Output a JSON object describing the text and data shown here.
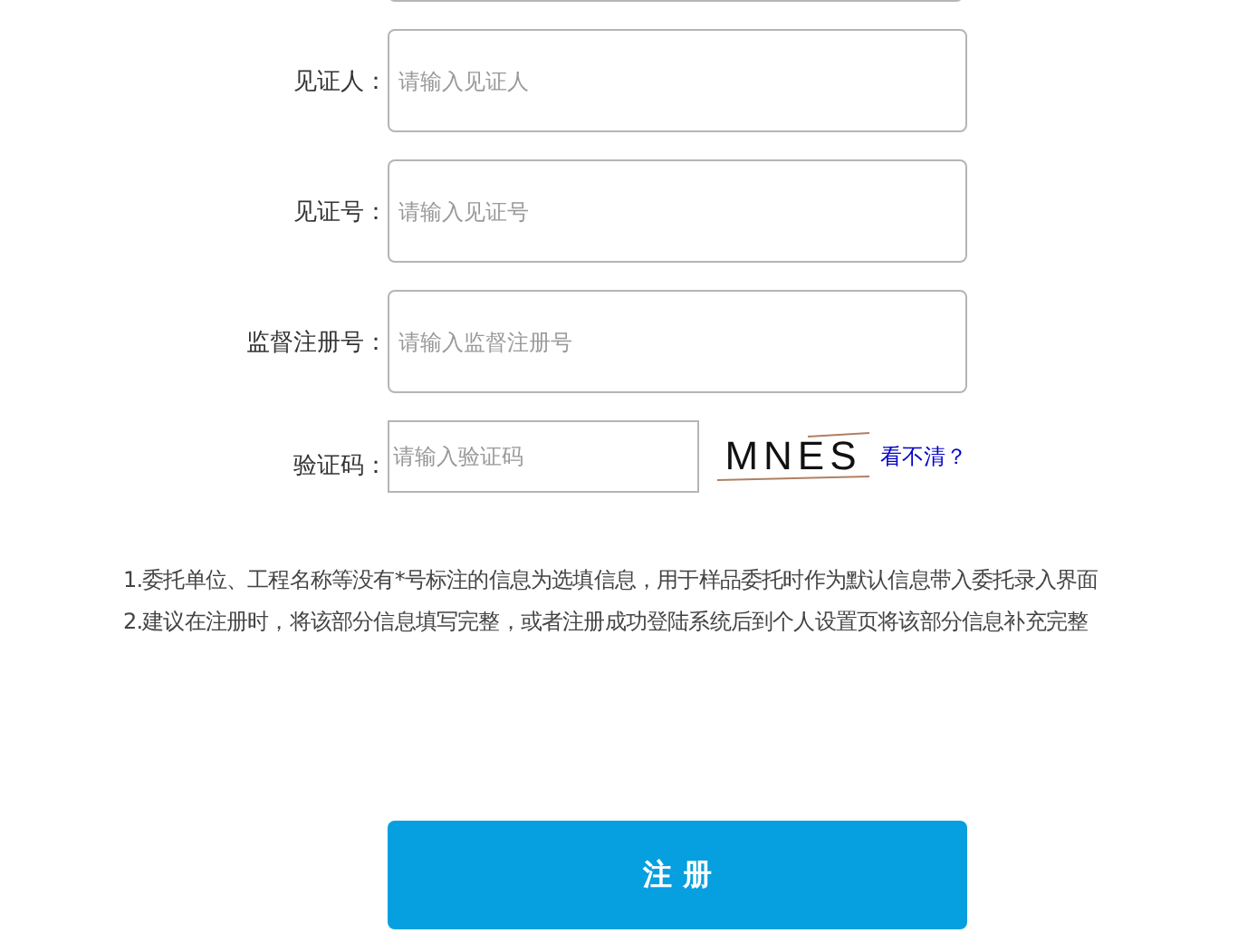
{
  "fields": [
    {
      "label": "见证人：",
      "placeholder": "请输入见证人"
    },
    {
      "label": "见证号：",
      "placeholder": "请输入见证号"
    },
    {
      "label": "监督注册号：",
      "placeholder": "请输入监督注册号"
    }
  ],
  "captcha": {
    "label": "验证码：",
    "placeholder": "请输入验证码",
    "code": "MNES",
    "refresh_link": "看不清？"
  },
  "notes": [
    "1.委托单位、工程名称等没有*号标注的信息为选填信息，用于样品委托时作为默认信息带入委托录入界面",
    "2.建议在注册时，将该部分信息填写完整，或者注册成功登陆系统后到个人设置页将该部分信息补充完整"
  ],
  "submit_button": "注 册"
}
